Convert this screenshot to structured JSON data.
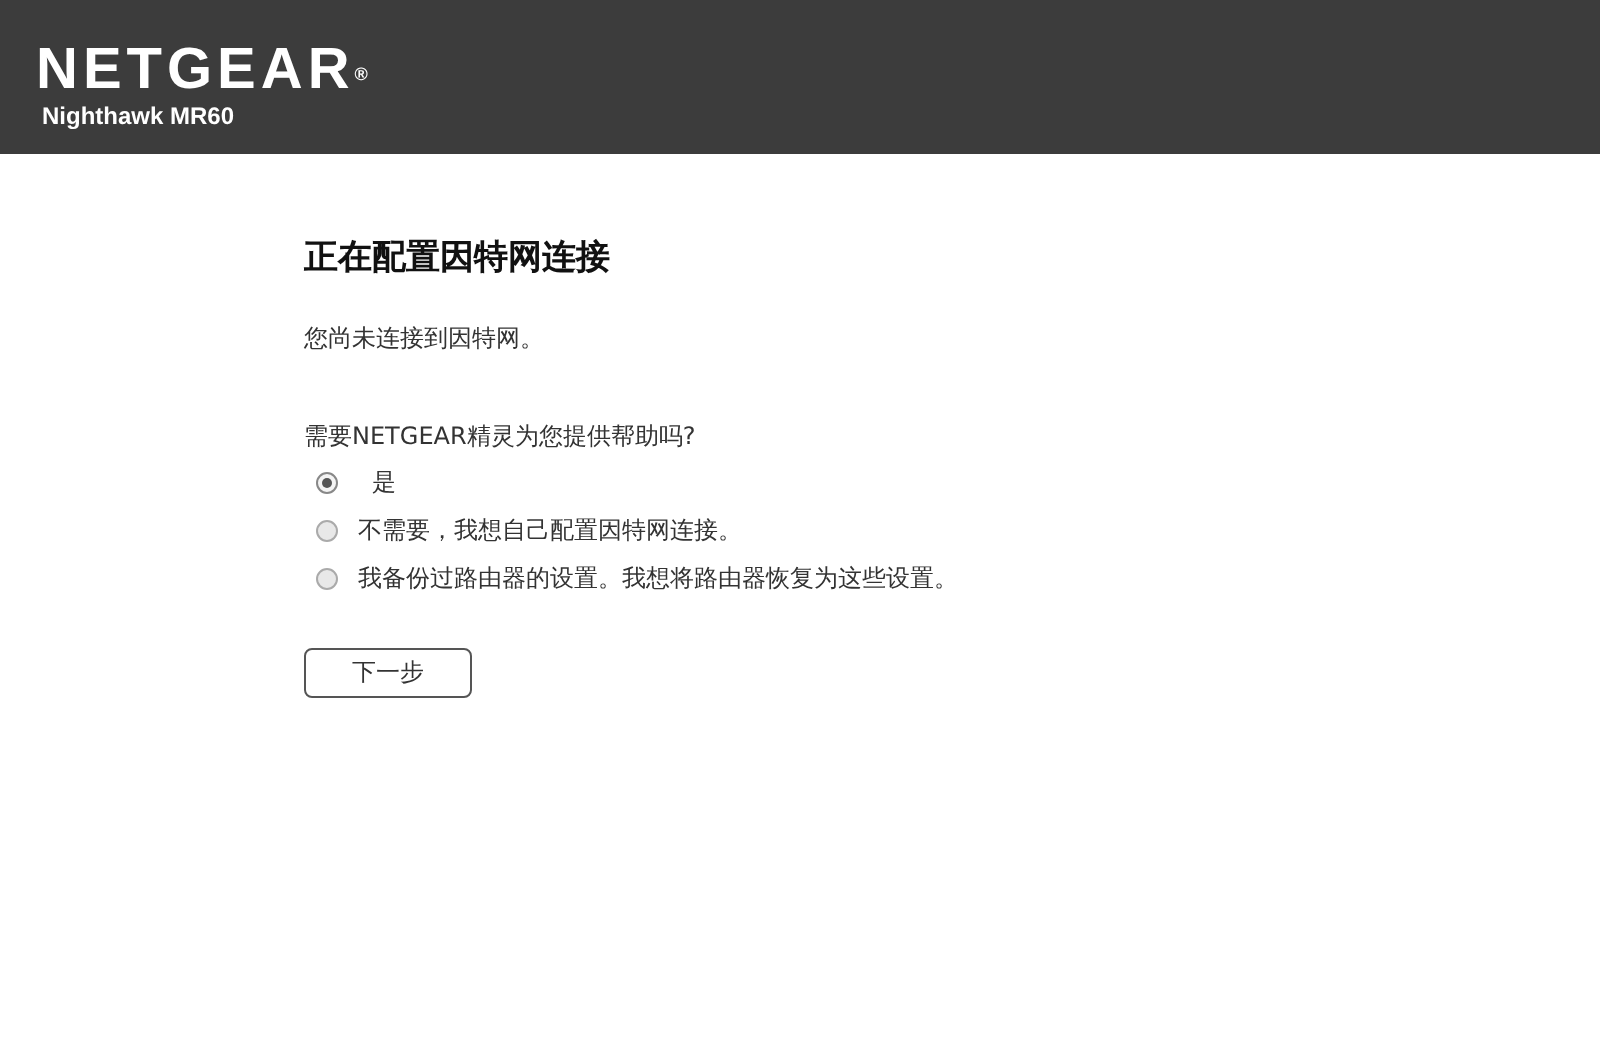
{
  "header": {
    "logo": "NETGEAR",
    "logo_mark": "®",
    "product": "Nighthawk MR60"
  },
  "title": "正在配置因特网连接",
  "status": "您尚未连接到因特网。",
  "question": "需要NETGEAR精灵为您提供帮助吗?",
  "options": [
    {
      "label": "是",
      "selected": true
    },
    {
      "label": "不需要，我想自己配置因特网连接。",
      "selected": false
    },
    {
      "label": "我备份过路由器的设置。我想将路由器恢复为这些设置。",
      "selected": false
    }
  ],
  "button": "下一步"
}
